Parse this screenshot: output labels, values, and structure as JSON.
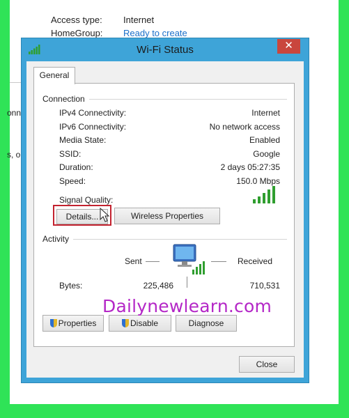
{
  "background_window": {
    "access_type_label": "Access type:",
    "access_type_value": "Internet",
    "homegroup_label": "HomeGroup:",
    "homegroup_value": "Ready to create",
    "side_text_1": "onn",
    "side_text_2": "s, o"
  },
  "dialog": {
    "title": "Wi-Fi Status",
    "close_glyph": "✕",
    "tab": "General",
    "connection": {
      "heading": "Connection",
      "rows": [
        {
          "label": "IPv4 Connectivity:",
          "value": "Internet"
        },
        {
          "label": "IPv6 Connectivity:",
          "value": "No network access"
        },
        {
          "label": "Media State:",
          "value": "Enabled"
        },
        {
          "label": "SSID:",
          "value": "Google"
        },
        {
          "label": "Duration:",
          "value": "2 days 05:27:35"
        },
        {
          "label": "Speed:",
          "value": "150.0 Mbps"
        }
      ],
      "signal_quality_label": "Signal Quality:",
      "signal_bars": 5,
      "details_button": "Details...",
      "wireless_properties_button": "Wireless Properties"
    },
    "activity": {
      "heading": "Activity",
      "sent_label": "Sent",
      "received_label": "Received",
      "bytes_label": "Bytes:",
      "bytes_sent": "225,486",
      "bytes_received": "710,531",
      "properties_button": "Properties",
      "disable_button": "Disable",
      "diagnose_button": "Diagnose"
    },
    "close_button": "Close"
  },
  "watermark": "Dailynewlearn.com",
  "colors": {
    "border_green": "#2fe357",
    "title_bar": "#3ea4d8",
    "close_red": "#c9463d",
    "highlight_red": "#c3222f",
    "signal_green": "#2f9e2f",
    "watermark": "#b427c7"
  }
}
